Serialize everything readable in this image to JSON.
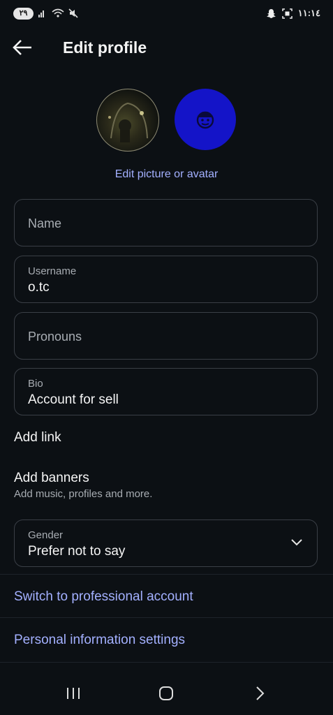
{
  "status_bar": {
    "battery": "٢٩",
    "time": "١١:١٤"
  },
  "header": {
    "title": "Edit profile"
  },
  "avatars": {
    "edit_label": "Edit picture or avatar"
  },
  "fields": {
    "name": {
      "placeholder": "Name"
    },
    "username": {
      "label": "Username",
      "value": "o.tc"
    },
    "pronouns": {
      "placeholder": "Pronouns"
    },
    "bio": {
      "label": "Bio",
      "value": "Account for sell"
    }
  },
  "links": {
    "add_link": "Add link",
    "add_banners": "Add banners",
    "add_banners_sub": "Add music, profiles and more."
  },
  "gender": {
    "label": "Gender",
    "value": "Prefer not to say"
  },
  "footer_links": {
    "professional": "Switch to professional account",
    "personal_info": "Personal information settings"
  },
  "colors": {
    "background": "#0c1014",
    "accent_link": "#a3b0ff",
    "avatar_blue": "#1414c8"
  }
}
